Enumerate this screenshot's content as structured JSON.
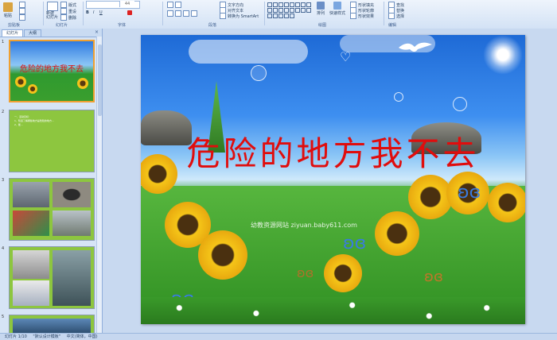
{
  "ribbon": {
    "groups": [
      "剪贴板",
      "幻灯片",
      "字体",
      "段落",
      "绘图",
      "编辑"
    ],
    "paste_label": "粘贴",
    "new_slide_label": "新建\n幻灯片",
    "layout_label": "版式",
    "reset_label": "重设",
    "delete_label": "删除",
    "font_size": "44",
    "text_direction_label": "文字方向",
    "align_text_label": "对齐文本",
    "smartart_label": "转换为 SmartArt",
    "arrange_label": "排列",
    "quick_styles_label": "快速样式",
    "shape_fill_label": "形状填充",
    "shape_outline_label": "形状轮廓",
    "shape_effects_label": "形状效果",
    "find_label": "查找",
    "replace_label": "替换",
    "select_label": "选择"
  },
  "left_panel": {
    "tabs": [
      "幻灯片",
      "大纲"
    ],
    "slide_numbers": [
      "1",
      "2",
      "3",
      "4",
      "5"
    ],
    "thumb1_title": "危险的地方我不去",
    "thumb2_text": "一、活动目标：\n1、知道了解哪些地方是危险的地方…\n2、能…"
  },
  "slide": {
    "title": "危险的地方我不去",
    "watermark": "幼教资源网站 ziyuan.baby611.com"
  },
  "status": {
    "slide_counter": "幻灯片 1/10",
    "theme": "\"默认设计模板\"",
    "language": "中文(简体，中国)"
  },
  "colors": {
    "title_red": "#e00d0d",
    "thumb_green": "#8dc63f",
    "selection_border": "#f0a030"
  }
}
